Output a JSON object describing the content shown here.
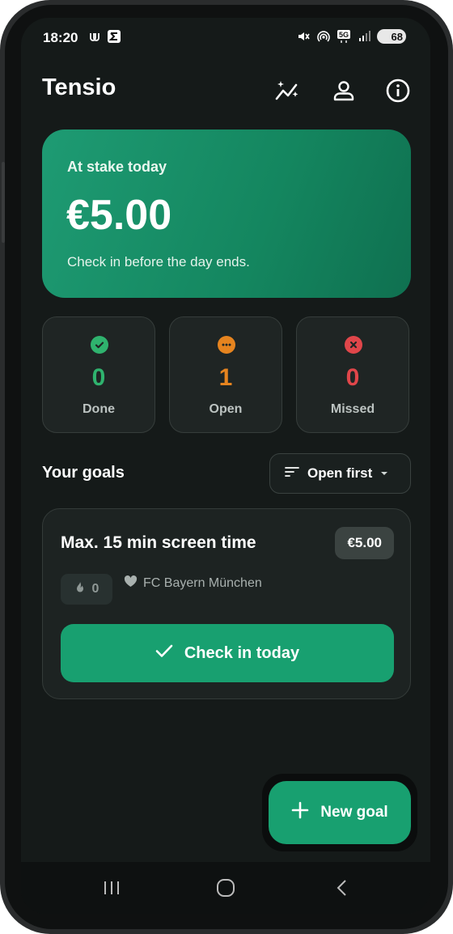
{
  "status_bar": {
    "time": "18:20",
    "battery": "68"
  },
  "app": {
    "title": "Tensio"
  },
  "stake_card": {
    "label": "At stake today",
    "amount": "€5.00",
    "subtitle": "Check in before the day ends."
  },
  "stats": [
    {
      "count": "0",
      "label": "Done",
      "color": "#2fb36e",
      "icon": "check-circle-icon"
    },
    {
      "count": "1",
      "label": "Open",
      "color": "#e6841f",
      "icon": "more-circle-icon"
    },
    {
      "count": "0",
      "label": "Missed",
      "color": "#e0464a",
      "icon": "x-circle-icon"
    }
  ],
  "goals_section": {
    "title": "Your goals",
    "sort_label": "Open first"
  },
  "goals": [
    {
      "title": "Max. 15 min screen time",
      "stake": "€5.00",
      "streak": "0",
      "charity": "FC Bayern München",
      "checkin_label": "Check in today"
    }
  ],
  "fab": {
    "label": "New goal"
  },
  "colors": {
    "accent": "#18a070",
    "background": "#151a19",
    "card": "#1f2524"
  }
}
